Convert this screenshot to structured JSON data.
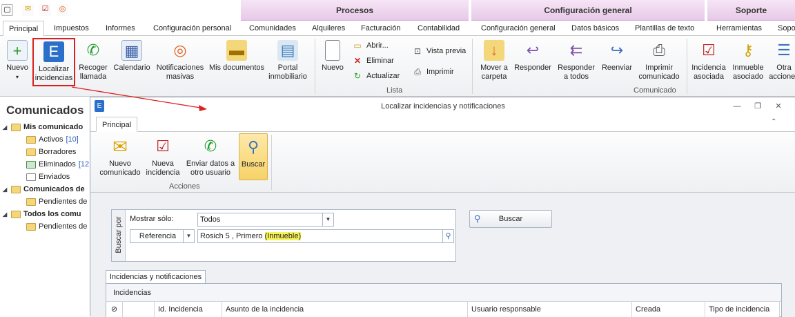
{
  "ribbon": {
    "context_groups": [
      "Procesos",
      "Configuración general",
      "Soporte"
    ],
    "tabs": [
      "Principal",
      "Impuestos",
      "Informes",
      "Configuración personal",
      "Comunidades",
      "Alquileres",
      "Facturación",
      "Contabilidad",
      "Configuración general",
      "Datos básicos",
      "Plantillas de texto",
      "Herramientas",
      "Sopo"
    ],
    "buttons": {
      "nuevo": "Nuevo",
      "localizar": "Localizar incidencias",
      "recoger": "Recoger llamada",
      "calendario": "Calendario",
      "notificaciones": "Notificaciones masivas",
      "documentos": "Mis documentos",
      "portal": "Portal inmobiliario",
      "nuevo2": "Nuevo",
      "abrir": "Abrir...",
      "eliminar": "Eliminar",
      "actualizar": "Actualizar",
      "vista": "Vista previa",
      "imprimir": "Imprimir",
      "mover": "Mover a carpeta",
      "responder": "Responder",
      "responder_todos": "Responder a todos",
      "reenviar": "Reenviar",
      "imprimir_com": "Imprimir comunicado",
      "inc_asociada": "Incidencia asociada",
      "inm_asociado": "Inmueble asociado",
      "otras": "Otra acciones"
    },
    "group_labels": {
      "lista": "Lista",
      "comunicado": "Comunicado"
    }
  },
  "nav": {
    "title": "Comunicados",
    "items": [
      {
        "label": "Mis comunicado",
        "bold": true
      },
      {
        "label": "Activos",
        "count": "[10]"
      },
      {
        "label": "Borradores"
      },
      {
        "label": "Eliminados",
        "count": "[12"
      },
      {
        "label": "Enviados"
      },
      {
        "label": "Comunicados de",
        "bold": true
      },
      {
        "label": "Pendientes de"
      },
      {
        "label": "Todos los comu",
        "bold": true
      },
      {
        "label": "Pendientes de"
      }
    ]
  },
  "dialog": {
    "title": "Localizar incidencias y notificaciones",
    "tab": "Principal",
    "actions": {
      "nuevo_comunicado": "Nuevo comunicado",
      "nueva_incidencia": "Nueva incidencia",
      "enviar_datos": "Enviar datos a otro usuario",
      "buscar": "Buscar",
      "group_label": "Acciones"
    },
    "search": {
      "group_label": "Buscar por",
      "mostrar_label": "Mostrar sólo:",
      "mostrar_value": "Todos",
      "referencia": "Referencia",
      "query_plain": "Rosich 5 , Primero ",
      "query_highlight": "(Inmueble)",
      "buscar_button": "Buscar"
    },
    "grid": {
      "tab": "Incidencias y notificaciones",
      "caption": "Incidencias",
      "columns": [
        "Id. Incidencia",
        "Asunto de la incidencia",
        "Usuario responsable",
        "Creada",
        "Tipo de incidencia"
      ]
    }
  },
  "colors": {
    "annotation_red": "#e02020",
    "highlight_yellow": "#f7f35a",
    "context_purple": "#e7c9e7"
  }
}
